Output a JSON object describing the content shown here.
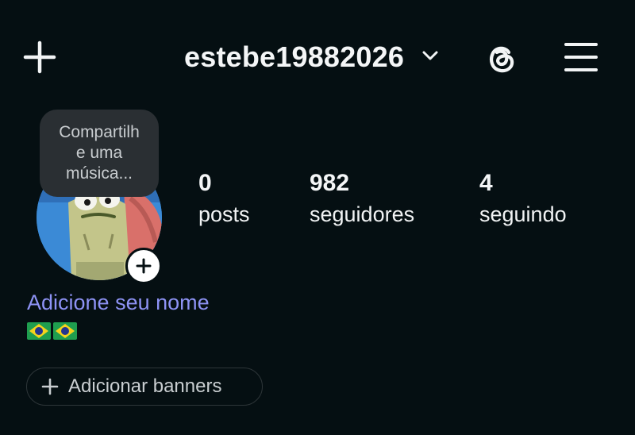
{
  "header": {
    "username": "estebe19882026",
    "icons": {
      "new": "plus-icon",
      "account_switch": "chevron-down-icon",
      "threads": "threads-icon",
      "menu": "hamburger-menu-icon"
    }
  },
  "profile": {
    "note_tooltip": "Compartilhe uma música...",
    "stats": [
      {
        "value": "0",
        "label": "posts"
      },
      {
        "value": "982",
        "label": "seguidores"
      },
      {
        "value": "4",
        "label": "seguindo"
      }
    ],
    "add_name": "Adicione seu nome",
    "bio_flags": "🇧🇷🇧🇷"
  },
  "actions": {
    "add_banners": "Adicionar banners"
  },
  "colors": {
    "background": "#050f12",
    "link": "#8e93f5"
  }
}
